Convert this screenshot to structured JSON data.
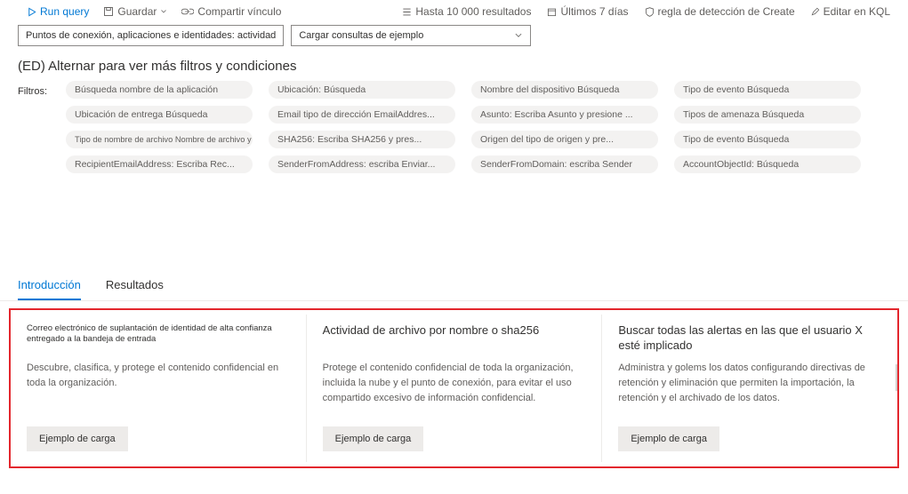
{
  "toolbar": {
    "run_query": "Run query",
    "save": "Guardar",
    "share": "Compartir vínculo",
    "results_limit": "Hasta 10 000 resultados",
    "time_range": "Últimos 7 días",
    "detection_rule": "regla de detección de Create",
    "edit_kql": "Editar en KQL"
  },
  "selectors": {
    "scope": "Puntos de conexión, aplicaciones e identidades: actividad",
    "load_examples": "Cargar consultas de ejemplo"
  },
  "section_title": "(ED) Alternar para ver más filtros y condiciones",
  "filters_label": "Filtros:",
  "filters": [
    [
      "Búsqueda nombre de la aplicación",
      "Ubicación: Búsqueda",
      "Nombre del dispositivo Búsqueda",
      "Tipo de evento Búsqueda"
    ],
    [
      "Ubicación de entrega Búsqueda",
      "Email tipo de dirección EmailAddres...",
      "Asunto: Escriba Asunto y presione ...",
      "Tipos de amenaza Búsqueda"
    ],
    [
      "Tipo de nombre de archivo Nombre de archivo y pr...",
      "SHA256: Escriba SHA256 y pres...",
      "Origen del tipo de origen y pre...",
      "Tipo de evento Búsqueda"
    ],
    [
      "RecipientEmailAddress: Escriba Rec...",
      "SenderFromAddress: escriba Enviar...",
      "SenderFromDomain: escriba Sender",
      "AccountObjectId: Búsqueda"
    ]
  ],
  "tabs": {
    "intro": "Introducción",
    "results": "Resultados"
  },
  "cards": [
    {
      "title": "Correo electrónico de suplantación de identidad de alta confianza entregado a la bandeja de entrada",
      "desc": "Descubre, clasifica, y protege el contenido confidencial en toda la organización.",
      "btn": "Ejemplo de carga",
      "small": true
    },
    {
      "title": "Actividad de archivo por nombre o sha256",
      "desc": "Protege el contenido confidencial de toda la organización, incluida la nube y el punto de conexión, para evitar el uso compartido excesivo de información confidencial.",
      "btn": "Ejemplo de carga",
      "small": false
    },
    {
      "title": "Buscar todas las alertas en las que el usuario X esté implicado",
      "desc": "Administra y golems los datos configurando directivas de retención y eliminación que permiten la importación, la retención y el archivado de los datos.",
      "btn": "Ejemplo de carga",
      "small": false
    }
  ]
}
